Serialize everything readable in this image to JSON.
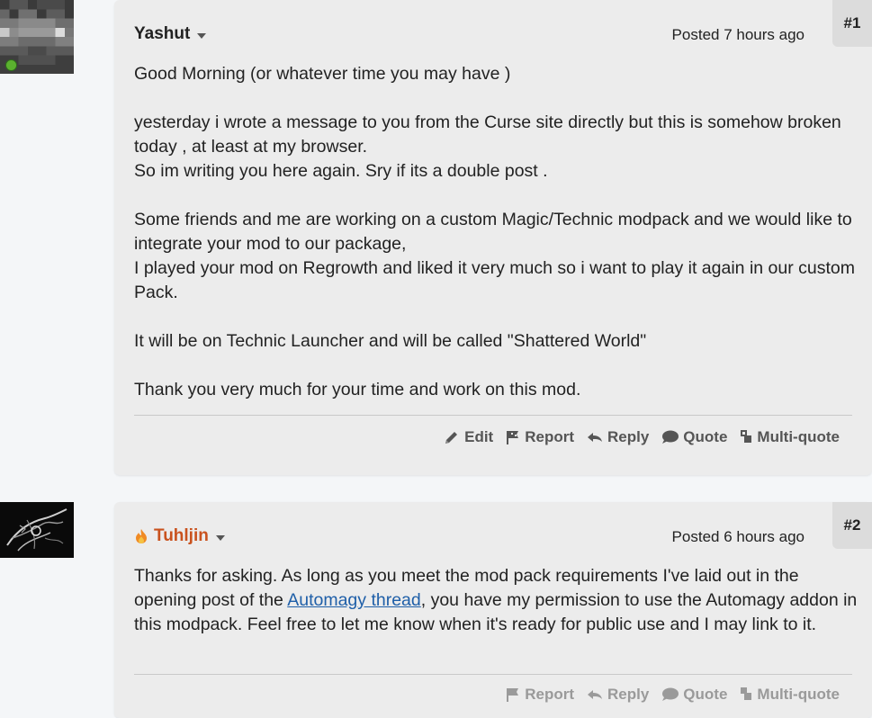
{
  "posts": [
    {
      "number": "#1",
      "author": "Yashut",
      "posted": "Posted 7 hours ago",
      "paragraphs": [
        "Good Morning (or whatever time you may have )",
        "yesterday i wrote a message to you from the Curse site directly but this is somehow broken today , at least at my browser.\nSo im writing you here again. Sry if its a double post .",
        "Some friends and me are working on a custom Magic/Technic modpack and we would like to integrate your mod to our package,\nI played your mod on Regrowth and liked it very much so i want to play it again in our custom Pack.",
        "It will be on Technic Launcher and will be called \"Shattered World\"",
        "Thank you very much for your time and work on this mod."
      ],
      "actions": [
        "Edit",
        "Report",
        "Reply",
        "Quote",
        "Multi-quote"
      ]
    },
    {
      "number": "#2",
      "author": "Tuhljin",
      "posted": "Posted 6 hours ago",
      "body_before_link": "Thanks for asking. As long as you meet the mod pack requirements I've laid out in the opening post of the ",
      "link_text": "Automagy thread",
      "body_after_link": ", you have my permission to use the Automagy addon in this modpack. Feel free to let me know when it's ready for public use and I may link to it.",
      "actions": [
        "Report",
        "Reply",
        "Quote",
        "Multi-quote"
      ]
    }
  ],
  "colors": {
    "staff_name": "#c9521e",
    "link": "#1f5fa8",
    "online": "#5bb12f"
  }
}
